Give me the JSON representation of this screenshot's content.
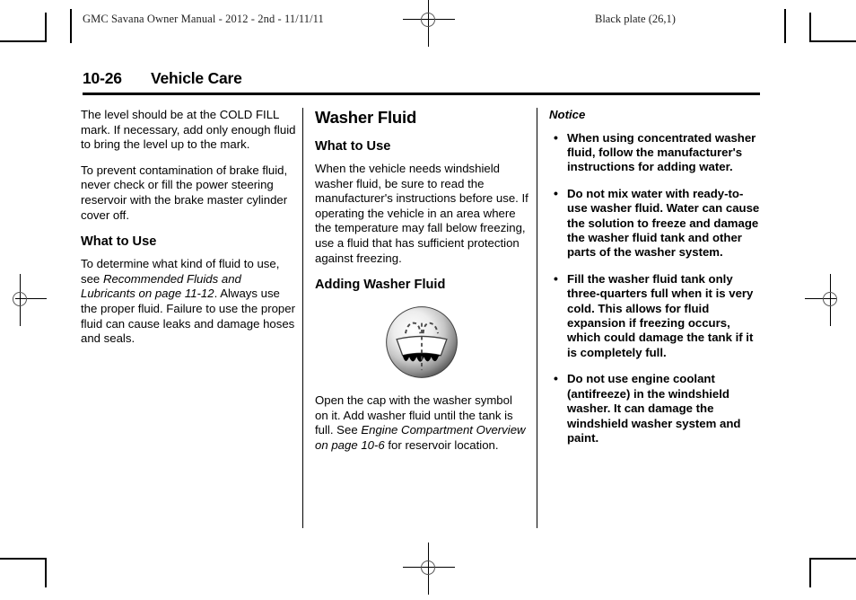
{
  "header": {
    "manual_line": "GMC Savana Owner Manual - 2012 - 2nd - 11/11/11",
    "plate_line": "Black plate (26,1)"
  },
  "title": {
    "page_number": "10-26",
    "section_name": "Vehicle Care"
  },
  "columns": {
    "left": {
      "paragraph_1": "The level should be at the COLD FILL mark. If necessary, add only enough fluid to bring the level up to the mark.",
      "paragraph_2": "To prevent contamination of brake fluid, never check or fill the power steering reservoir with the brake master cylinder cover off.",
      "heading_what_to_use": "What to Use",
      "paragraph_3_part_1": "To determine what kind of fluid to use, see ",
      "paragraph_3_italic": "Recommended Fluids and Lubricants on page 11-12",
      "paragraph_3_part_2": ". Always use the proper fluid. Failure to use the proper fluid can cause leaks and damage hoses and seals."
    },
    "middle": {
      "heading_washer_fluid": "Washer Fluid",
      "heading_what_to_use": "What to Use",
      "paragraph_1": "When the vehicle needs windshield washer fluid, be sure to read the manufacturer's instructions before use. If operating the vehicle in an area where the temperature may fall below freezing, use a fluid that has sufficient protection against freezing.",
      "heading_adding_washer_fluid": "Adding Washer Fluid",
      "icon_name": "windshield-washer-symbol",
      "paragraph_2_part_1": "Open the cap with the washer symbol on it. Add washer fluid until the tank is full. See ",
      "paragraph_2_italic": "Engine Compartment Overview on page 10-6",
      "paragraph_2_part_2": " for reservoir location."
    },
    "right": {
      "notice_label": "Notice",
      "bullet_char": "•",
      "notices": [
        "When using concentrated washer fluid, follow the manufacturer's instructions for adding water.",
        "Do not mix water with ready-to-use washer fluid. Water can cause the solution to freeze and damage the washer fluid tank and other parts of the washer system.",
        "Fill the washer fluid tank only three-quarters full when it is very cold. This allows for fluid expansion if freezing occurs, which could damage the tank if it is completely full.",
        "Do not use engine coolant (antifreeze) in the windshield washer. It can damage the windshield washer system and paint."
      ]
    }
  },
  "print_marks": {
    "registration_top": "registration-target-top",
    "registration_bottom": "registration-target-bottom",
    "registration_left": "registration-target-left",
    "registration_right": "registration-target-right"
  },
  "colors": {
    "text": "#000000",
    "header_text": "#222222",
    "rule": "#000000",
    "icon_light": "#ffffff",
    "icon_mid": "#b9b9b9",
    "icon_dark": "#5c5c5c"
  }
}
